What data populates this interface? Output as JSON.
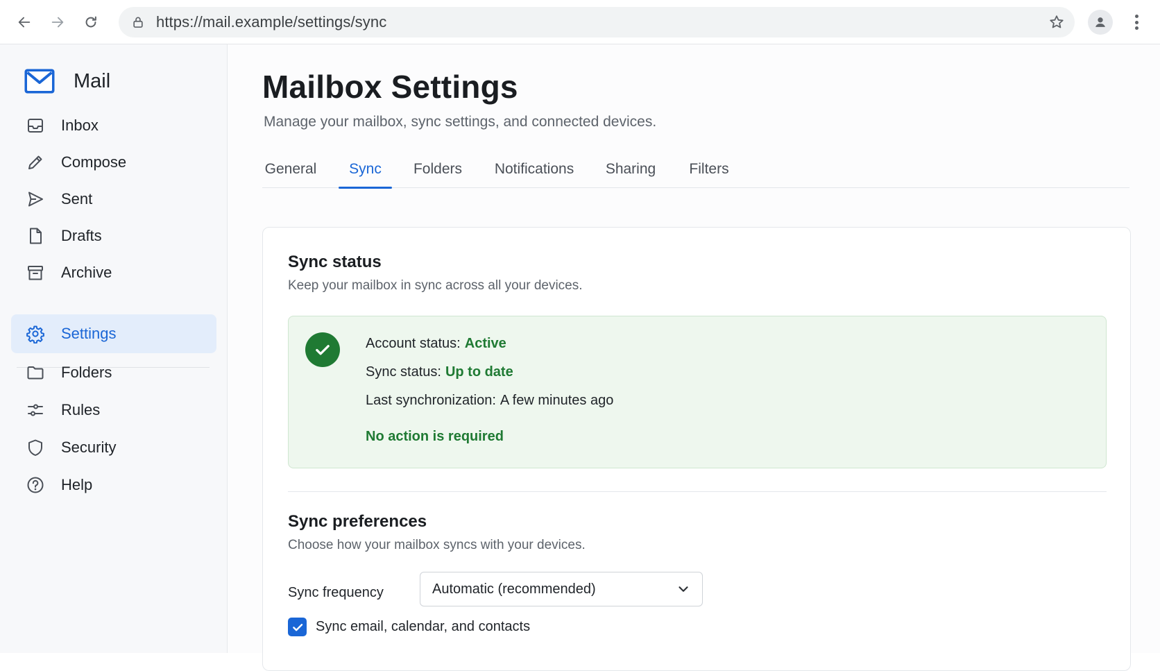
{
  "browser": {
    "url": "https://mail.example/settings/sync"
  },
  "sidebar": {
    "app_name": "Mail",
    "items": [
      {
        "label": "Inbox",
        "icon": "inbox-icon"
      },
      {
        "label": "Compose",
        "icon": "pencil-icon"
      },
      {
        "label": "Sent",
        "icon": "send-icon"
      },
      {
        "label": "Drafts",
        "icon": "draft-icon"
      },
      {
        "label": "Archive",
        "icon": "archive-icon"
      },
      {
        "label": "Settings",
        "icon": "gear-icon",
        "active": true
      },
      {
        "label": "Folders",
        "icon": "folder-icon"
      },
      {
        "label": "Rules",
        "icon": "sliders-icon"
      },
      {
        "label": "Security",
        "icon": "shield-icon"
      },
      {
        "label": "Help",
        "icon": "help-icon"
      }
    ]
  },
  "page": {
    "title": "Mailbox Settings",
    "subtitle": "Manage your mailbox, sync settings, and connected devices."
  },
  "tabs": [
    {
      "label": "General"
    },
    {
      "label": "Sync",
      "active": true
    },
    {
      "label": "Folders"
    },
    {
      "label": "Notifications"
    },
    {
      "label": "Sharing"
    },
    {
      "label": "Filters"
    }
  ],
  "sync_status": {
    "title": "Sync status",
    "subtitle": "Keep your mailbox in sync across all your devices.",
    "account_label": "Account status:",
    "account_value": "Active",
    "sync_label": "Sync status:",
    "sync_value": "Up to date",
    "last_label": "Last synchronization:",
    "last_value": "A few minutes ago",
    "message": "No action is required"
  },
  "sync_prefs": {
    "title": "Sync preferences",
    "subtitle": "Choose how your mailbox syncs with your devices.",
    "frequency_label": "Sync frequency",
    "frequency_value": "Automatic (recommended)",
    "checkbox_label": "Sync email, calendar, and contacts",
    "checkbox_checked": true
  },
  "colors": {
    "accent": "#1a66d6",
    "success": "#1f7a33",
    "success_bg": "#eef7ee"
  }
}
